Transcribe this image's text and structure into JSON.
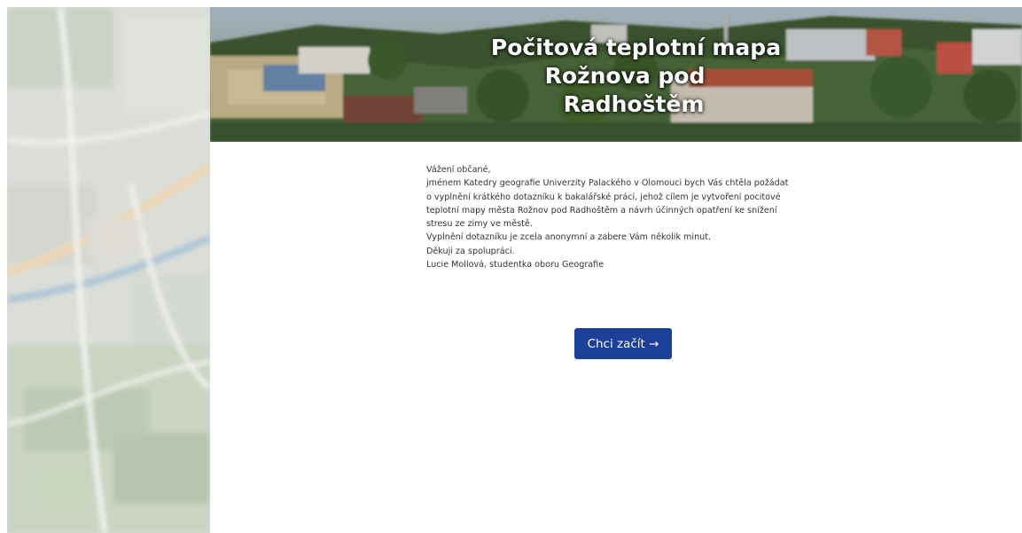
{
  "banner": {
    "title_line1": "Počitová teplotní mapa",
    "title_line2": "Rožnova pod",
    "title_line3": "Radhoštěm"
  },
  "intro": {
    "greeting": "Vážení občané,",
    "lines": [
      "jménem Katedry geografie Univerzity Palackého v Olomouci bych Vás chtěla požádat",
      "o vyplnění krátkého dotazníku k bakalářské práci, jehož cílem je vytvoření pocitové",
      "teplotní mapy města Rožnov pod Radhoštěm a návrh účinných opatření ke snížení",
      "stresu ze zimy ve městě.",
      "Vyplnění dotazníku je zcela anonymní a zabere Vám několik minut.",
      "Děkuji za spolupráci.",
      "Lucie Mollová, studentka oboru Geografie"
    ]
  },
  "start_button": {
    "label": "Chci začít →",
    "color": "#1c3f97"
  },
  "icons": {
    "map": "blurred-city-map",
    "banner": "town-panorama-photo"
  }
}
